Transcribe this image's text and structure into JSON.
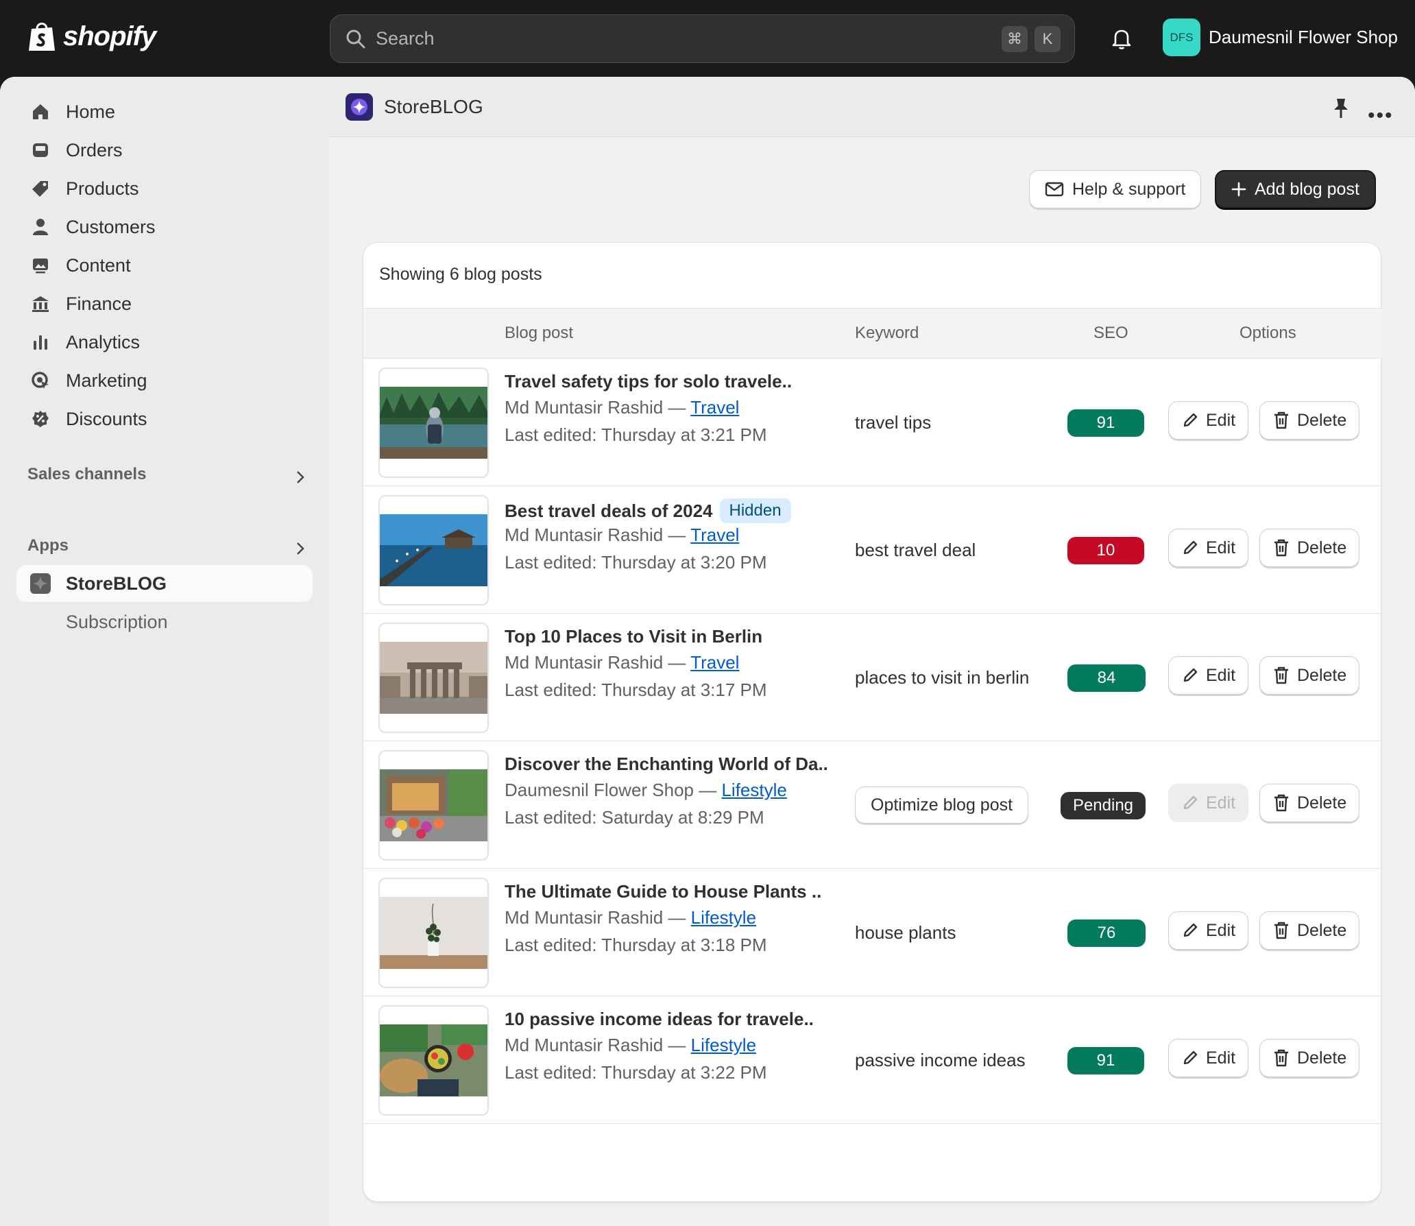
{
  "topbar": {
    "brand": "shopify",
    "search_placeholder": "Search",
    "shortcut_cmd": "⌘",
    "shortcut_key": "K",
    "store_initials": "DFS",
    "store_name": "Daumesnil Flower Shop"
  },
  "sidebar": {
    "items": [
      {
        "label": "Home",
        "icon": "home-icon"
      },
      {
        "label": "Orders",
        "icon": "inbox-icon"
      },
      {
        "label": "Products",
        "icon": "tag-icon"
      },
      {
        "label": "Customers",
        "icon": "person-icon"
      },
      {
        "label": "Content",
        "icon": "image-icon"
      },
      {
        "label": "Finance",
        "icon": "bank-icon"
      },
      {
        "label": "Analytics",
        "icon": "bar-chart-icon"
      },
      {
        "label": "Marketing",
        "icon": "target-icon"
      },
      {
        "label": "Discounts",
        "icon": "discount-icon"
      }
    ],
    "sales_channels": "Sales channels",
    "apps": "Apps",
    "app_item": "StoreBLOG",
    "app_sub_item": "Subscription"
  },
  "app": {
    "title": "StoreBLOG",
    "help_label": "Help & support",
    "add_label": "Add blog post",
    "showing": "Showing 6 blog posts",
    "columns": {
      "post": "Blog post",
      "keyword": "Keyword",
      "seo": "SEO",
      "options": "Options"
    },
    "edit_label": "Edit",
    "delete_label": "Delete",
    "optimize_label": "Optimize blog post"
  },
  "posts": [
    {
      "title": "Travel safety tips for solo travele..",
      "author": "Md Muntasir Rashid — ",
      "category": "Travel",
      "edited": "Last edited: Thursday at 3:21 PM",
      "keyword": "travel tips",
      "seo": "91",
      "status": "good",
      "badge": ""
    },
    {
      "title": "Best travel deals of 2024",
      "author": "Md Muntasir Rashid — ",
      "category": "Travel",
      "edited": "Last edited: Thursday at 3:20 PM",
      "keyword": "best travel deal",
      "seo": "10",
      "status": "bad",
      "badge": "Hidden"
    },
    {
      "title": "Top 10 Places to Visit in Berlin",
      "author": "Md Muntasir Rashid — ",
      "category": "Travel",
      "edited": "Last edited: Thursday at 3:17 PM",
      "keyword": "places to visit in berlin",
      "seo": "84",
      "status": "good",
      "badge": ""
    },
    {
      "title": "Discover the Enchanting World of Da..",
      "author": "Daumesnil Flower Shop — ",
      "category": "Lifestyle",
      "edited": "Last edited: Saturday at 8:29 PM",
      "keyword": "",
      "seo": "Pending",
      "status": "pend",
      "badge": ""
    },
    {
      "title": "The Ultimate Guide to House Plants ..",
      "author": "Md Muntasir Rashid — ",
      "category": "Lifestyle",
      "edited": "Last edited: Thursday at 3:18 PM",
      "keyword": "house plants",
      "seo": "76",
      "status": "good",
      "badge": ""
    },
    {
      "title": "10 passive income ideas for travele..",
      "author": "Md Muntasir Rashid — ",
      "category": "Lifestyle",
      "edited": "Last edited: Thursday at 3:22 PM",
      "keyword": "passive income ideas",
      "seo": "91",
      "status": "good",
      "badge": ""
    }
  ]
}
